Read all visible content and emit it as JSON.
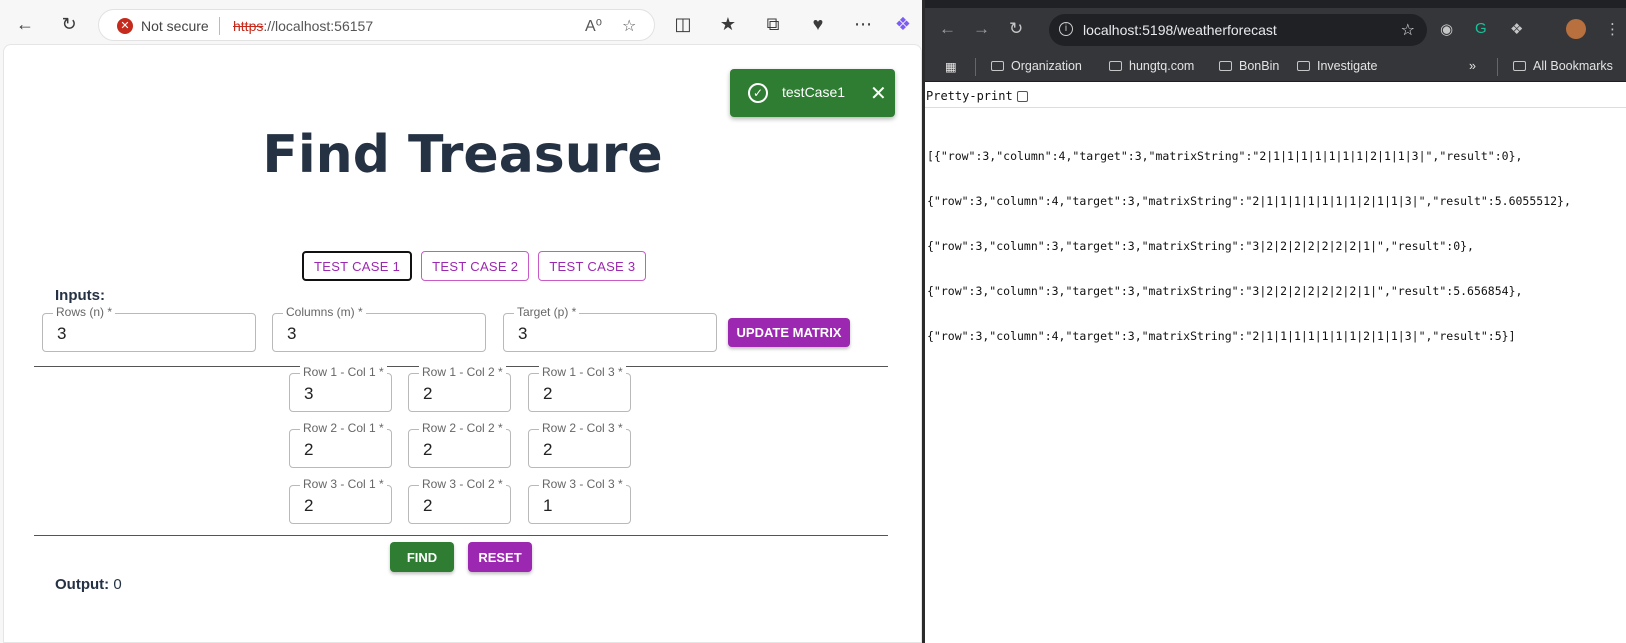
{
  "left_browser": {
    "address_bar": {
      "security_text": "Not secure",
      "url_protocol": "https",
      "url_rest": "://localhost:56157"
    },
    "page": {
      "title": "Find Treasure",
      "test_cases": [
        "TEST CASE 1",
        "TEST CASE 2",
        "TEST CASE 3"
      ],
      "inputs_label": "Inputs:",
      "rows_field": {
        "label": "Rows (n) *",
        "value": "3"
      },
      "columns_field": {
        "label": "Columns (m) *",
        "value": "3"
      },
      "target_field": {
        "label": "Target (p) *",
        "value": "3"
      },
      "update_button": "UPDATE MATRIX",
      "matrix": [
        [
          {
            "label": "Row 1 - Col 1 *",
            "value": "3"
          },
          {
            "label": "Row 1 - Col 2 *",
            "value": "2"
          },
          {
            "label": "Row 1 - Col 3 *",
            "value": "2"
          }
        ],
        [
          {
            "label": "Row 2 - Col 1 *",
            "value": "2"
          },
          {
            "label": "Row 2 - Col 2 *",
            "value": "2"
          },
          {
            "label": "Row 2 - Col 3 *",
            "value": "2"
          }
        ],
        [
          {
            "label": "Row 3 - Col 1 *",
            "value": "2"
          },
          {
            "label": "Row 3 - Col 2 *",
            "value": "2"
          },
          {
            "label": "Row 3 - Col 3 *",
            "value": "1"
          }
        ]
      ],
      "find_button": "FIND",
      "reset_button": "RESET",
      "output_label": "Output:",
      "output_value": "0"
    },
    "toast": {
      "message": "testCase1",
      "color": "#2e7d32"
    }
  },
  "right_browser": {
    "url": "localhost:5198/weatherforecast",
    "bookmarks": [
      "Organization",
      "hungtq.com",
      "BonBin",
      "Investigate"
    ],
    "all_bookmarks": "All Bookmarks",
    "pretty_print_label": "Pretty-print",
    "json_lines": [
      "[{\"row\":3,\"column\":4,\"target\":3,\"matrixString\":\"2|1|1|1|1|1|1|1|2|1|1|3|\",\"result\":0},",
      "{\"row\":3,\"column\":4,\"target\":3,\"matrixString\":\"2|1|1|1|1|1|1|1|2|1|1|3|\",\"result\":5.6055512},",
      "{\"row\":3,\"column\":3,\"target\":3,\"matrixString\":\"3|2|2|2|2|2|2|2|1|\",\"result\":0},",
      "{\"row\":3,\"column\":3,\"target\":3,\"matrixString\":\"3|2|2|2|2|2|2|2|1|\",\"result\":5.656854},",
      "{\"row\":3,\"column\":4,\"target\":3,\"matrixString\":\"2|1|1|1|1|1|1|1|2|1|1|3|\",\"result\":5}]"
    ]
  },
  "colors": {
    "accent_purple": "#9c27b0",
    "success_green": "#2e7d32",
    "title_navy": "#253244"
  }
}
